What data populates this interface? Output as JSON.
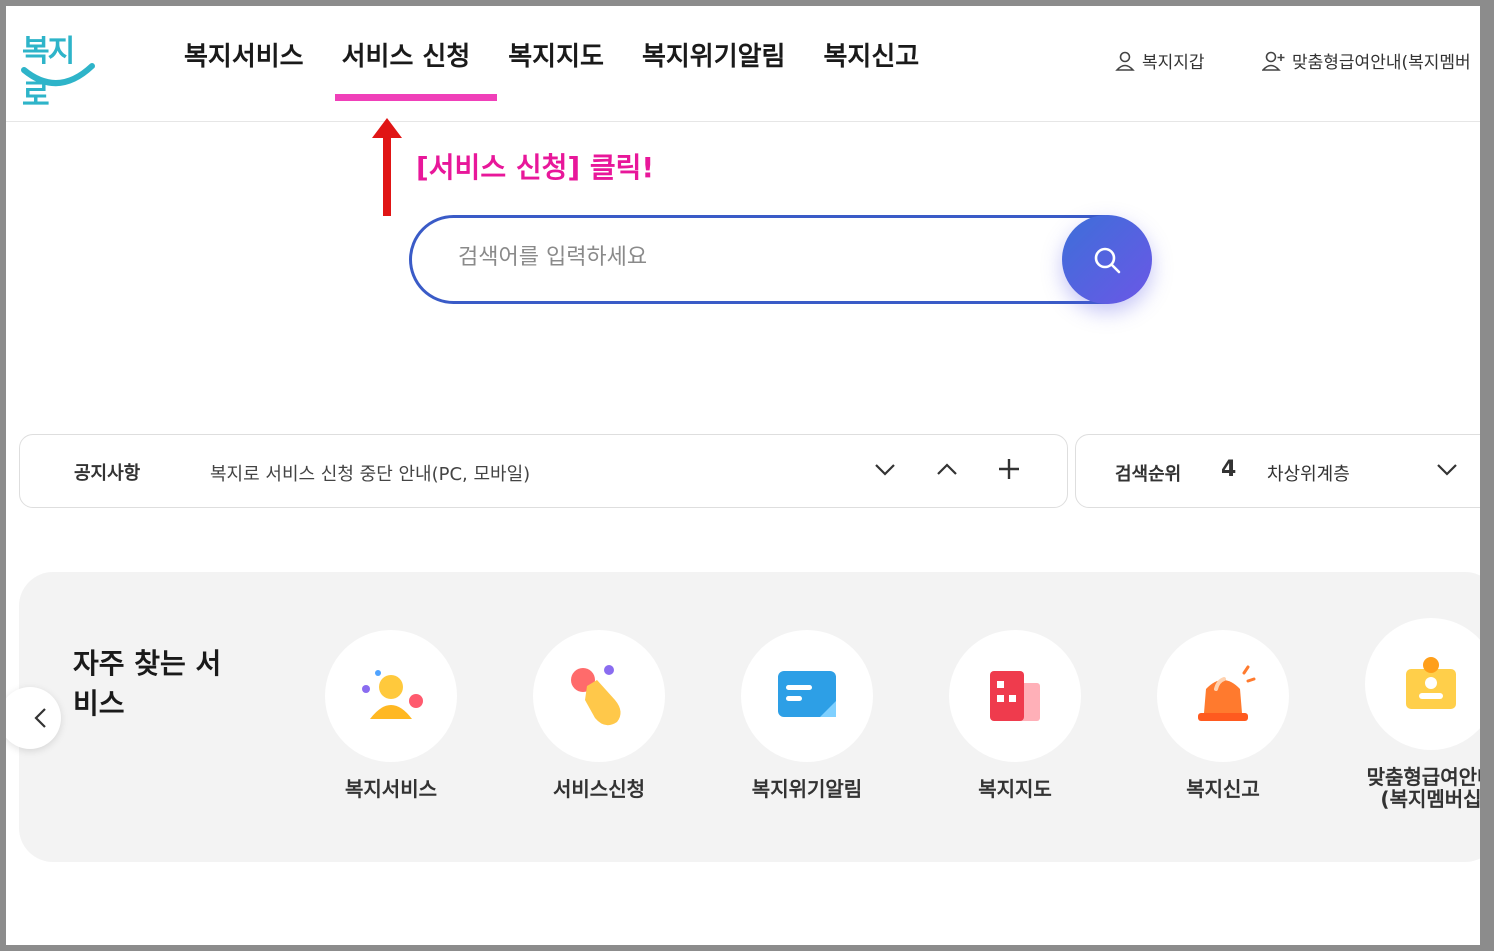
{
  "header": {
    "logo_text": "복지로",
    "nav": [
      "복지서비스",
      "서비스 신청",
      "복지지도",
      "복지위기알림",
      "복지신고"
    ],
    "wallet_label": "복지지갑",
    "custom_label": "맞춤형급여안내(복지멤버"
  },
  "annotation": {
    "text": "[서비스 신청] 클릭!",
    "color": "#e8179a"
  },
  "search": {
    "placeholder": "검색어를 입력하세요",
    "value": ""
  },
  "notice": {
    "label": "공지사항",
    "text": "복지로 서비스 신청 중단 안내(PC, 모바일)"
  },
  "rank": {
    "label": "검색순위",
    "number": "4",
    "term": "차상위계층"
  },
  "frequent": {
    "title": "자주 찾는 서비스",
    "items": [
      {
        "label": "복지서비스",
        "icon": "person-icon"
      },
      {
        "label": "서비스신청",
        "icon": "hand-click-icon"
      },
      {
        "label": "복지위기알림",
        "icon": "message-icon"
      },
      {
        "label": "복지지도",
        "icon": "building-icon"
      },
      {
        "label": "복지신고",
        "icon": "siren-icon"
      },
      {
        "label": "맞춤형급여안내",
        "label2": "(복지멤버십",
        "icon": "badge-icon"
      }
    ]
  },
  "colors": {
    "accent": "#f040b9",
    "search_border": "#3a5bc7",
    "logo": "#2eb4c9"
  }
}
